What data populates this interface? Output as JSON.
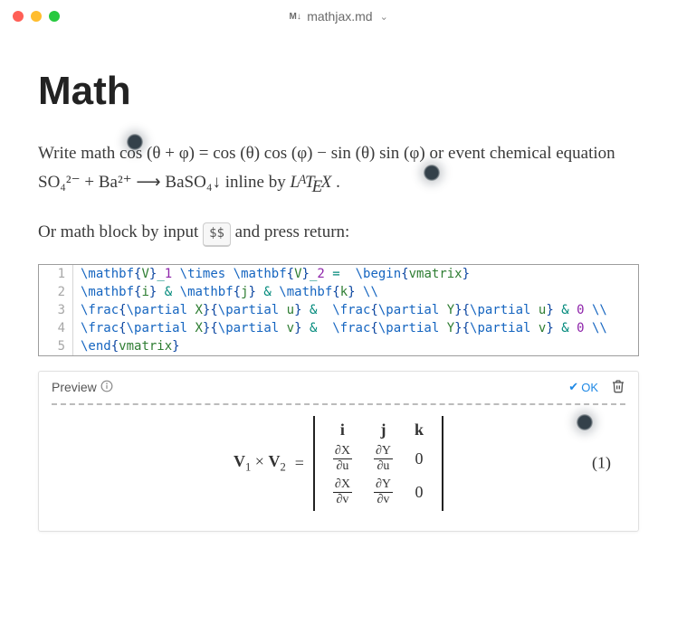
{
  "titlebar": {
    "filename": "mathjax.md"
  },
  "heading": "Math",
  "paragraph1": {
    "prefix": "Write math ",
    "inline_math": "cos (θ + φ) = cos (θ) cos (φ) − sin (θ) sin (φ)",
    "mid": "  or event chemical equation ",
    "inline_chem": "SO₄²⁻ + Ba²⁺ ⟶ BaSO₄↓",
    "suffix1": " inline by ",
    "latex_word": "LATEX",
    "suffix2": "."
  },
  "paragraph2": {
    "prefix": "Or math block by input ",
    "key": "$$",
    "suffix": " and press return:"
  },
  "code_lines": [
    "\\mathbf{V}_1 \\times \\mathbf{V}_2 =  \\begin{vmatrix}",
    "\\mathbf{i} & \\mathbf{j} & \\mathbf{k} \\\\",
    "\\frac{\\partial X}{\\partial u} &  \\frac{\\partial Y}{\\partial u} & 0 \\\\",
    "\\frac{\\partial X}{\\partial v} &  \\frac{\\partial Y}{\\partial v} & 0 \\\\",
    "\\end{vmatrix}"
  ],
  "preview": {
    "label": "Preview",
    "ok_label": "OK",
    "eq_number": "(1)",
    "lhs_v1": "V",
    "lhs_sub1": "1",
    "lhs_times": "×",
    "lhs_v2": "V",
    "lhs_sub2": "2",
    "eq_sign": "=",
    "row0c0": "i",
    "row0c1": "j",
    "row0c2": "k",
    "dX": "∂X",
    "dY": "∂Y",
    "du": "∂u",
    "dv": "∂v",
    "zero": "0"
  }
}
